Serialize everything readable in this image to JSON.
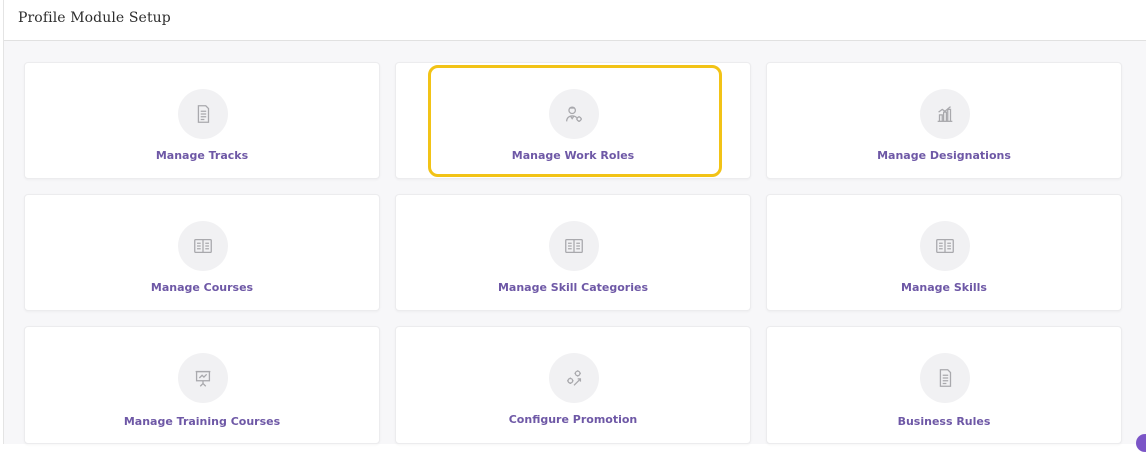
{
  "header": {
    "title": "Profile Module Setup"
  },
  "cards": [
    {
      "label": "Manage Tracks",
      "icon": "document-icon"
    },
    {
      "label": "Manage Work Roles",
      "icon": "user-gear-icon"
    },
    {
      "label": "Manage Designations",
      "icon": "building-chart-icon"
    },
    {
      "label": "Manage Courses",
      "icon": "book-icon"
    },
    {
      "label": "Manage Skill Categories",
      "icon": "book-icon"
    },
    {
      "label": "Manage Skills",
      "icon": "book-icon"
    },
    {
      "label": "Manage Training Courses",
      "icon": "presentation-board-icon"
    },
    {
      "label": "Configure Promotion",
      "icon": "promotion-gear-icon"
    },
    {
      "label": "Business Rules",
      "icon": "document-icon"
    }
  ],
  "highlighted_card": "Manage Work Roles",
  "colors": {
    "label": "#6e58a6",
    "highlight": "#f2c316",
    "icon": "#a9a9ad"
  }
}
